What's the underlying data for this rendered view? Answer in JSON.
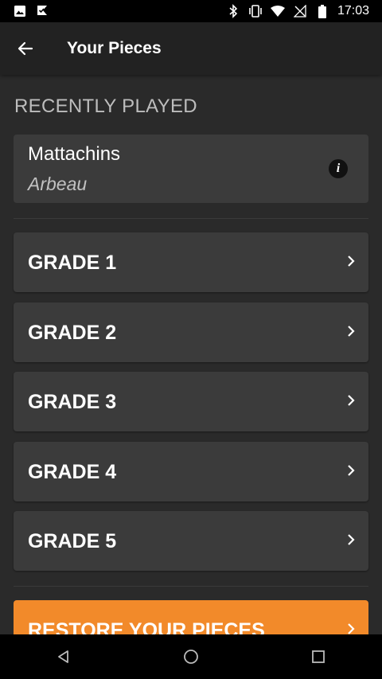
{
  "status_bar": {
    "time": "17:03",
    "icons_left": [
      "image-icon",
      "check-flag-icon"
    ],
    "icons_right": [
      "bluetooth-icon",
      "vibrate-icon",
      "wifi-icon",
      "no-signal-icon",
      "battery-icon"
    ]
  },
  "app_bar": {
    "title": "Your Pieces",
    "back_icon": "arrow-left-icon"
  },
  "recent": {
    "section_title": "RECENTLY PLAYED",
    "item": {
      "title": "Mattachins",
      "composer": "Arbeau",
      "info_icon": "info-icon"
    }
  },
  "grades": [
    {
      "label": "GRADE 1"
    },
    {
      "label": "GRADE 2"
    },
    {
      "label": "GRADE 3"
    },
    {
      "label": "GRADE 4"
    },
    {
      "label": "GRADE 5"
    }
  ],
  "restore": {
    "label": "RESTORE YOUR PIECES"
  },
  "nav_bar": {
    "icons": [
      "back-triangle-icon",
      "home-circle-icon",
      "recents-square-icon"
    ]
  },
  "colors": {
    "accent": "#f28a2a",
    "card": "#3b3b3b",
    "background": "#2a2a2a",
    "app_bar": "#222222"
  }
}
